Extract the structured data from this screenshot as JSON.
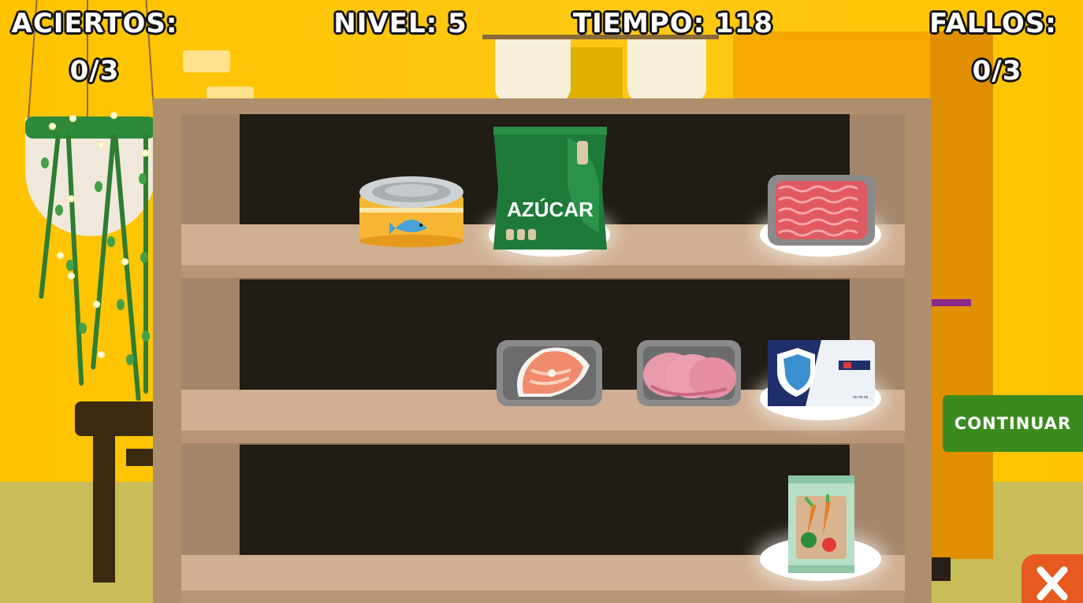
{
  "hud": {
    "aciertos_label": "ACIERTOS:",
    "aciertos_value": "0/3",
    "nivel": "NIVEL: 5",
    "tiempo": "TIEMPO: 118",
    "fallos_label": "FALLOS:",
    "fallos_value": "0/3"
  },
  "shelf": {
    "items": [
      {
        "name": "canned-tuna",
        "icon": "tuna-can-icon",
        "shelf": 1
      },
      {
        "name": "sugar-bag",
        "label": "AZÚCAR",
        "icon": "sugar-bag-icon",
        "shelf": 1
      },
      {
        "name": "ground-meat-tray",
        "icon": "ground-meat-icon",
        "shelf": 1
      },
      {
        "name": "salmon-steak-tray",
        "icon": "salmon-icon",
        "shelf": 2
      },
      {
        "name": "ham-slices-tray",
        "icon": "ham-icon",
        "shelf": 2
      },
      {
        "name": "butter-box",
        "icon": "butter-box-icon",
        "shelf": 2
      },
      {
        "name": "canned-vegetables",
        "icon": "vegetable-can-icon",
        "shelf": 3
      }
    ]
  },
  "buttons": {
    "continue": "CONTINUAR",
    "close_icon": "close-icon"
  },
  "colors": {
    "wall": "#ffc400",
    "shelf_frame": "#ae8f6d",
    "shelf_back": "#211c14",
    "continue_button": "#3a8a1e",
    "close_button": "#e65a20"
  }
}
